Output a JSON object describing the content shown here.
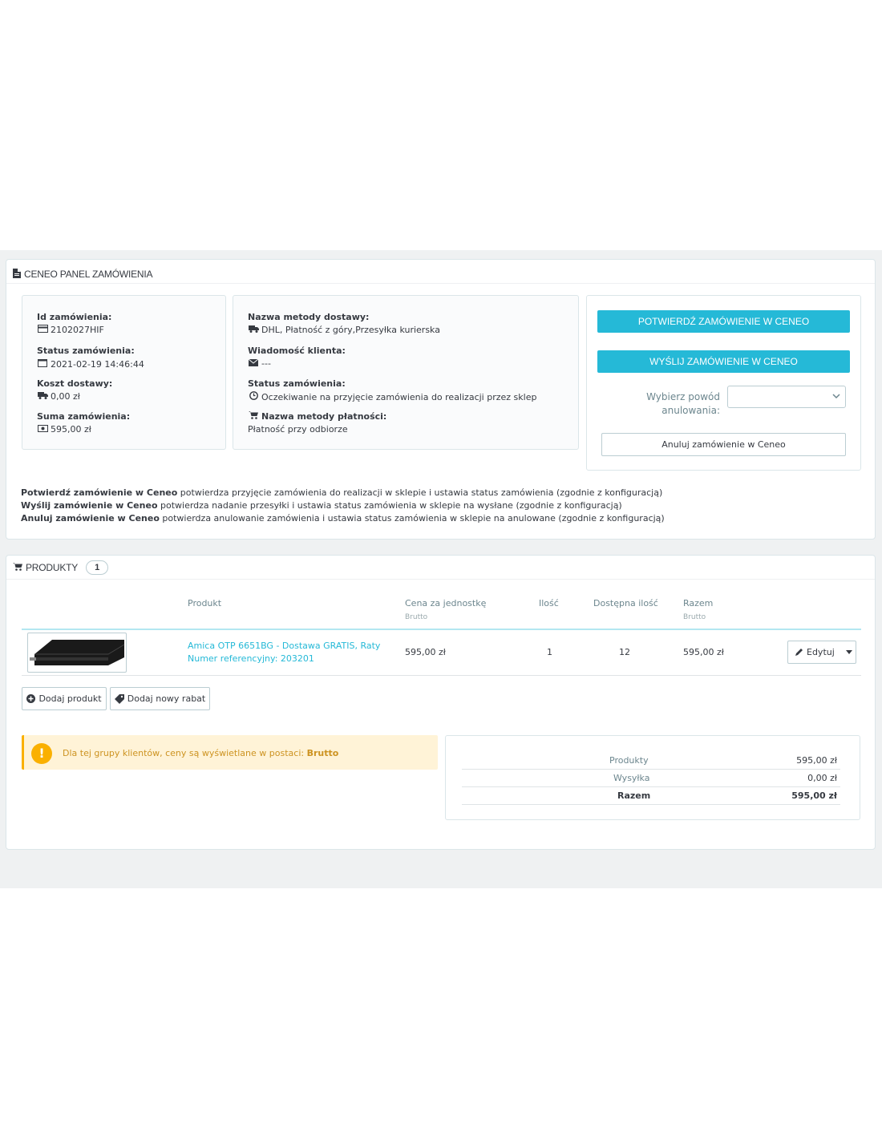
{
  "ceneo_panel": {
    "title": "CENEO PANEL ZAMÓWIENIA",
    "order_info": {
      "id_label": "Id zamówienia:",
      "id_value": "2102027HIF",
      "status_label": "Status zamówienia:",
      "status_value": "2021-02-19 14:46:44",
      "shipping_cost_label": "Koszt dostawy:",
      "shipping_cost_value": "0,00 zł",
      "total_label": "Suma zamówienia:",
      "total_value": "595,00 zł"
    },
    "delivery_info": {
      "method_label": "Nazwa metody dostawy:",
      "method_value": "DHL, Płatność z góry,Przesyłka kurierska",
      "message_label": "Wiadomość klienta:",
      "message_value": "---",
      "status_label": "Status zamówienia:",
      "status_value": "Oczekiwanie na przyjęcie zamówienia do realizacji przez sklep",
      "payment_label": "Nazwa metody płatności:",
      "payment_value": "Płatność przy odbiorze"
    },
    "actions": {
      "confirm_label": "POTWIERDŹ ZAMÓWIENIE W CENEO",
      "send_label": "WYŚLIJ ZAMÓWIENIE W CENEO",
      "reason_label_line1": "Wybierz powód",
      "reason_label_line2": "anulowania:",
      "reason_selected": "",
      "cancel_label": "Anuluj zamówienie w Ceneo"
    },
    "descriptions": [
      {
        "bold": "Potwierdź zamówienie w Ceneo",
        "text": " potwierdza przyjęcie zamówienia do realizacji w sklepie i ustawia status zamówienia (zgodnie z konfiguracją)"
      },
      {
        "bold": "Wyślij zamówienie w Ceneo",
        "text": " potwierdza nadanie przesyłki i ustawia status zamówienia w sklepie na wysłane (zgodnie z konfiguracją)"
      },
      {
        "bold": "Anuluj zamówienie w Ceneo",
        "text": " potwierdza anulowanie zamówienia i ustawia status zamówienia w sklepie na anulowane (zgodnie z konfiguracją)"
      }
    ]
  },
  "products_panel": {
    "title": "PRODUKTY",
    "count": "1",
    "columns": {
      "product": "Produkt",
      "unit_price": "Cena za jednostkę",
      "unit_price_sub": "Brutto",
      "quantity": "Ilość",
      "available": "Dostępna ilość",
      "total": "Razem",
      "total_sub": "Brutto"
    },
    "rows": [
      {
        "name": "Amica OTP 6651BG - Dostawa GRATIS, Raty",
        "reference": "Numer referencyjny: 203201",
        "unit_price": "595,00 zł",
        "quantity": "1",
        "available": "12",
        "total": "595,00 zł",
        "edit_label": "Edytuj"
      }
    ],
    "add_product_label": "Dodaj produkt",
    "add_discount_label": "Dodaj nowy rabat",
    "alert_text": "Dla tej grupy klientów, ceny są wyświetlane w postaci: ",
    "alert_bold": "Brutto",
    "totals": [
      {
        "label": "Produkty",
        "value": "595,00 zł"
      },
      {
        "label": "Wysyłka",
        "value": "0,00 zł"
      },
      {
        "label": "Razem",
        "value": "595,00 zł"
      }
    ]
  },
  "colors": {
    "accent": "#25b9d7",
    "warning": "#fab000",
    "background": "#eff1f2"
  }
}
